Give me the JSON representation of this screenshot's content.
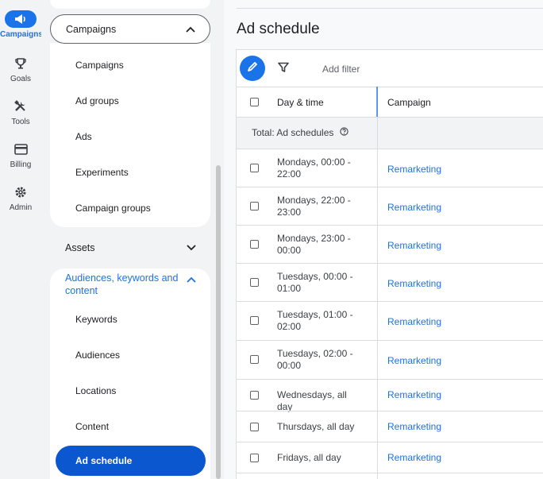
{
  "rail": {
    "items": [
      {
        "label": "Campaigns",
        "icon": "campaigns-megaphone-icon",
        "active": true
      },
      {
        "label": "Goals",
        "icon": "trophy-icon"
      },
      {
        "label": "Tools",
        "icon": "tools-icon"
      },
      {
        "label": "Billing",
        "icon": "credit-card-icon"
      },
      {
        "label": "Admin",
        "icon": "gear-icon"
      }
    ]
  },
  "nav": {
    "campaigns_section": {
      "label": "Campaigns",
      "items": [
        "Campaigns",
        "Ad groups",
        "Ads",
        "Experiments",
        "Campaign groups"
      ]
    },
    "assets_section": {
      "label": "Assets"
    },
    "audiences_section": {
      "label": "Audiences, keywords and content",
      "items": [
        "Keywords",
        "Audiences",
        "Locations",
        "Content"
      ],
      "active_item": "Ad schedule"
    }
  },
  "main": {
    "title": "Ad schedule",
    "toolbar": {
      "add_filter": "Add filter"
    },
    "table": {
      "columns": [
        "Day & time",
        "Campaign"
      ],
      "total_label": "Total: Ad schedules",
      "rows": [
        {
          "day_time": "Mondays, 00:00 - 22:00",
          "campaign": "Remarketing"
        },
        {
          "day_time": "Mondays, 22:00 - 23:00",
          "campaign": "Remarketing"
        },
        {
          "day_time": "Mondays, 23:00 - 00:00",
          "campaign": "Remarketing"
        },
        {
          "day_time": "Tuesdays, 00:00 - 01:00",
          "campaign": "Remarketing"
        },
        {
          "day_time": "Tuesdays, 01:00 - 02:00",
          "campaign": "Remarketing"
        },
        {
          "day_time": "Tuesdays, 02:00 - 00:00",
          "campaign": "Remarketing"
        },
        {
          "day_time": "Wednesdays, all day",
          "campaign": "Remarketing"
        },
        {
          "day_time": "Thursdays, all day",
          "campaign": "Remarketing"
        },
        {
          "day_time": "Fridays, all day",
          "campaign": "Remarketing"
        }
      ]
    }
  },
  "colors": {
    "accent": "#1a73e8",
    "active_nav": "#0b57d0",
    "rail_bg": "#f1f3f4"
  }
}
